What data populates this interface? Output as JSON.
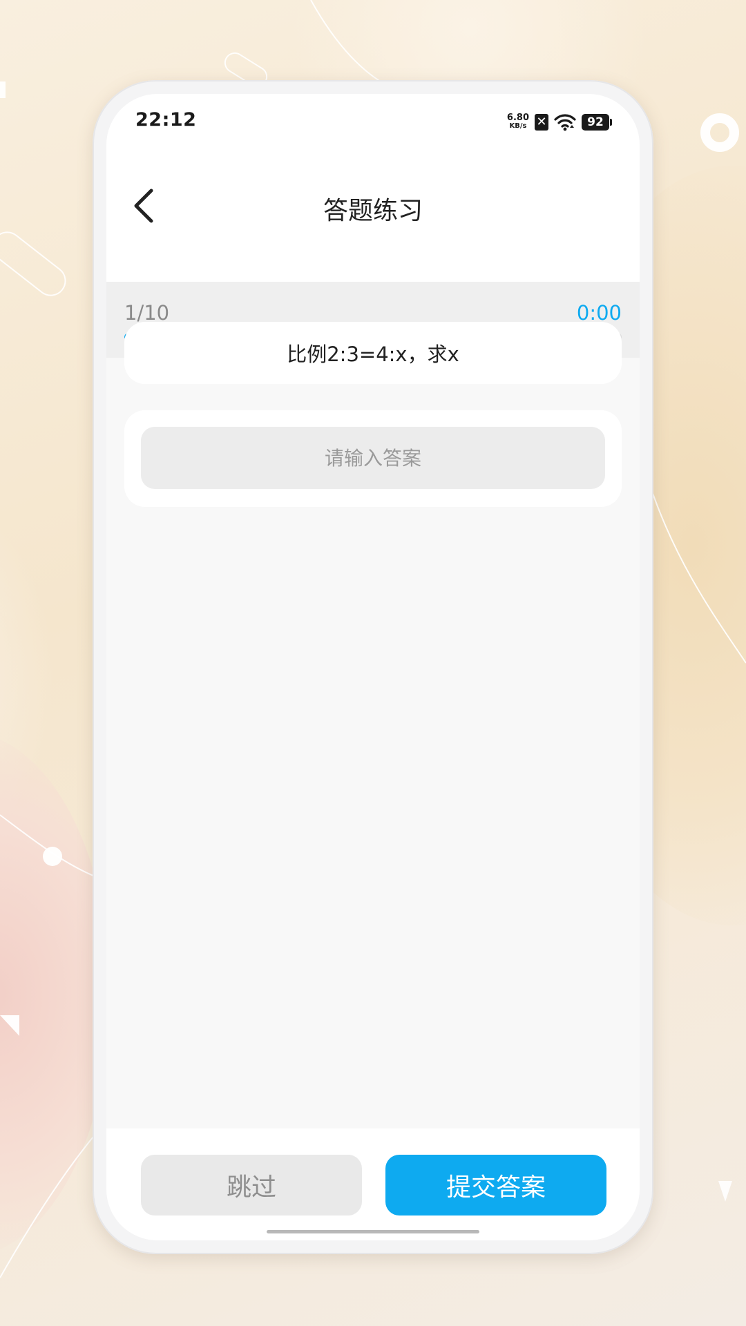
{
  "status_bar": {
    "time": "22:12",
    "net_speed_value": "6.80",
    "net_speed_unit": "KB/s",
    "battery_level": "92",
    "icons": [
      "sim-disabled-icon",
      "wifi-icon",
      "battery-icon"
    ]
  },
  "nav": {
    "title": "答题练习",
    "back_icon": "chevron-left-icon"
  },
  "progress": {
    "label": "1/10",
    "current": 1,
    "total": 10,
    "timer": "0:00",
    "fill_fraction": 0.1
  },
  "question": {
    "text": "比例2:3=4:x，求x"
  },
  "answer": {
    "placeholder": "请输入答案",
    "value": ""
  },
  "actions": {
    "skip_label": "跳过",
    "submit_label": "提交答案"
  },
  "colors": {
    "accent": "#0eaaf0",
    "progress_track": "#dddddd",
    "skip_bg": "#e9e9e9",
    "screen_bg": "#f8f8f8"
  }
}
